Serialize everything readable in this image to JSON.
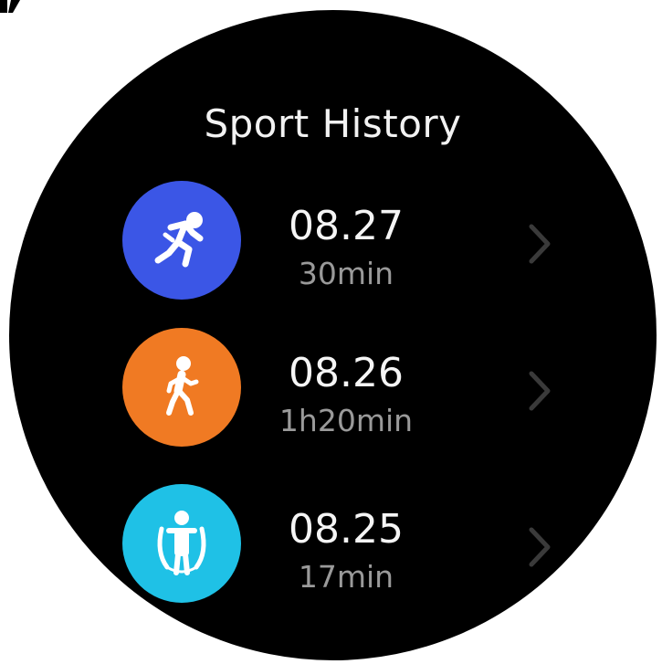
{
  "screen": {
    "title": "Sport History"
  },
  "history": [
    {
      "date": "08.27",
      "duration": "30min",
      "sport": "running",
      "icon": "running-icon",
      "color": "#3b56e6"
    },
    {
      "date": "08.26",
      "duration": "1h20min",
      "sport": "walking",
      "icon": "walking-icon",
      "color": "#f07a23"
    },
    {
      "date": "08.25",
      "duration": "17min",
      "sport": "jump rope",
      "icon": "jump-rope-icon",
      "color": "#1fc1e6"
    }
  ],
  "colors": {
    "background": "#000000",
    "title": "#f2f2f2",
    "date": "#f5f5f5",
    "duration": "#9a9a9a",
    "chevron": "#3a3a3a"
  }
}
